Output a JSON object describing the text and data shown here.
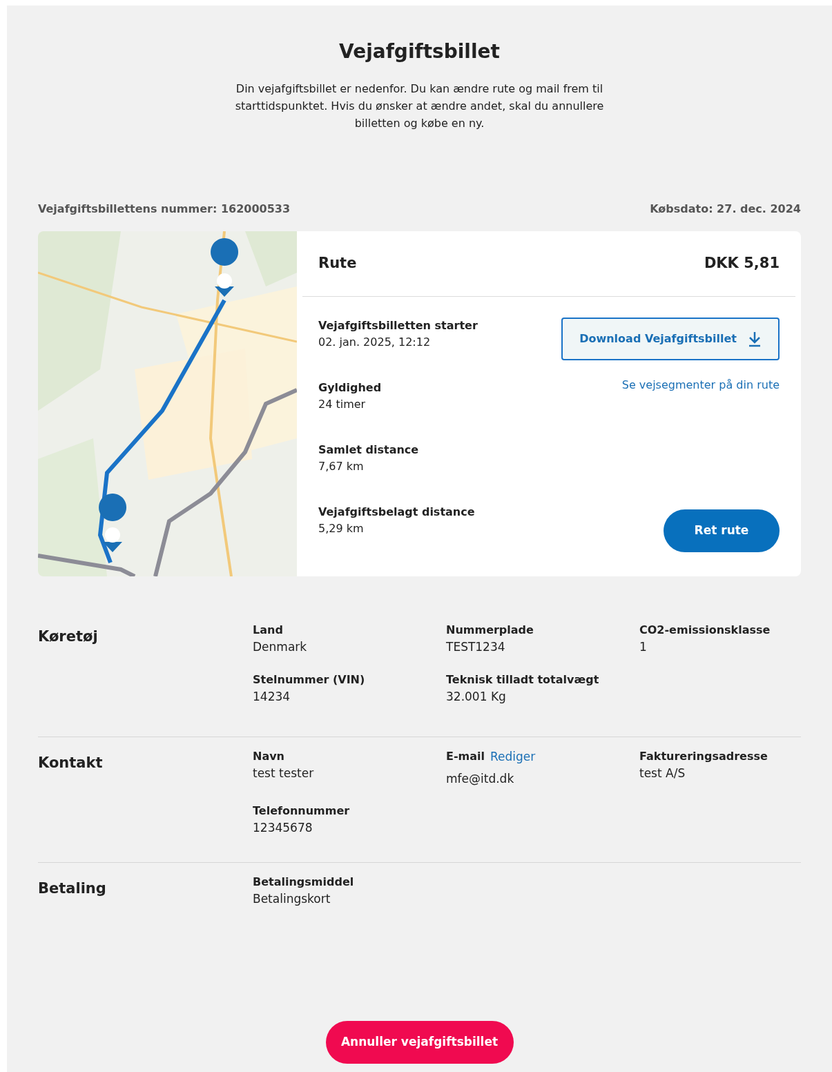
{
  "title": "Vejafgiftsbillet",
  "intro": "Din vejafgiftsbillet er nedenfor. Du kan ændre rute og mail frem til starttidspunktet. Hvis du ønsker at ændre andet, skal du annullere billetten og købe en ny.",
  "ticket_number": "Vejafgiftsbillettens nummer: 162000533",
  "purchase_date": "Købsdato: 27. dec. 2024",
  "route": {
    "title": "Rute",
    "price": "DKK 5,81",
    "details": [
      {
        "label": "Vejafgiftsbilletten starter",
        "value": "02. jan. 2025, 12:12"
      },
      {
        "label": "Gyldighed",
        "value": "24 timer"
      },
      {
        "label": "Samlet distance",
        "value": "7,67 km"
      },
      {
        "label": "Vejafgiftsbelagt distance",
        "value": "5,29 km"
      }
    ],
    "download_button": "Download Vejafgiftsbillet",
    "segments_link": "Se vejsegmenter på din rute",
    "edit_route_button": "Ret rute"
  },
  "sections": [
    {
      "title": "Køretøj",
      "fields": [
        {
          "label": "Land",
          "value": "Denmark"
        },
        {
          "label": "Nummerplade",
          "value": "TEST1234"
        },
        {
          "label": "CO2-emissionsklasse",
          "value": "1"
        },
        {
          "label": "Stelnummer (VIN)",
          "value": "14234"
        },
        {
          "label": "Teknisk tilladt totalvægt",
          "value": "32.001 Kg"
        }
      ]
    },
    {
      "title": "Kontakt",
      "fields": [
        {
          "label": "Navn",
          "value": "test tester"
        },
        {
          "label": "E-mail",
          "action": "Rediger",
          "value": "mfe@itd.dk"
        },
        {
          "label": "Faktureringsadresse",
          "value": "test A/S"
        },
        {
          "label": "Telefonnummer",
          "value": "12345678"
        }
      ]
    },
    {
      "title": "Betaling",
      "fields": [
        {
          "label": "Betalingsmiddel",
          "value": "Betalingskort"
        }
      ]
    }
  ],
  "cancel_button": "Annuller vejafgiftsbillet"
}
